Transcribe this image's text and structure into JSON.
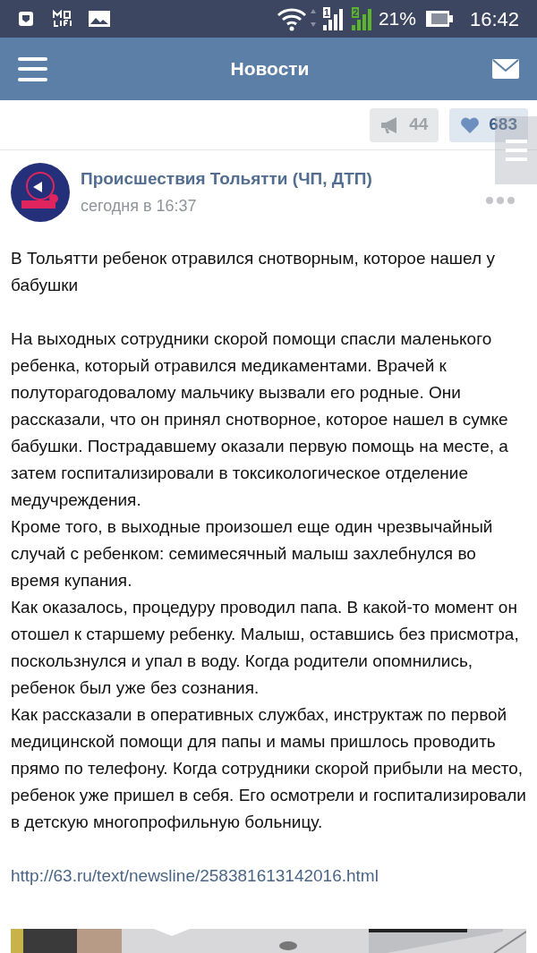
{
  "status_bar": {
    "sims": [
      "1",
      "2"
    ],
    "battery": "21%",
    "time": "16:42"
  },
  "header": {
    "title": "Новости"
  },
  "actions": [
    {
      "kind": "repost",
      "count": "44",
      "selected": false
    },
    {
      "kind": "like",
      "count": "683",
      "selected": true
    }
  ],
  "post": {
    "author": "Происшествия Тольятти (ЧП, ДТП)",
    "time": "сегодня в 16:37",
    "title": "В Тольятти ребенок отравился снотворным, которое нашел у бабушки",
    "paragraphs": [
      "На выходных сотрудники скорой помощи спасли маленького ребенка, который отравился медикаментами. Врачей к полуторагодовалому мальчику вызвали его родные. Они рассказали, что он принял снотворное, которое нашел в сумке бабушки. Пострадавшему оказали первую помощь на месте, а затем госпитализировали в токсикологическое отделение медучреждения.",
      "Кроме того, в выходные произошел еще один чрезвычайный случай с ребенком: семимесячный малыш захлебнулся во время купания.",
      "Как оказалось, процедуру проводил папа. В какой-то момент он отошел к старшему ребенку. Малыш, оставшись без присмотра, поскользнулся и упал в воду. Когда родители опомнились, ребенок был уже без сознания.",
      "Как рассказали в оперативных службах, инструктаж по первой медицинской помощи для папы и мамы пришлось проводить прямо по телефону. Когда сотрудники скорой прибыли на место, ребенок уже пришел в себя. Его осмотрели и госпитализировали в детскую многопрофильную больницу."
    ],
    "link": "http://63.ru/text/newsline/258381613142016.html"
  }
}
